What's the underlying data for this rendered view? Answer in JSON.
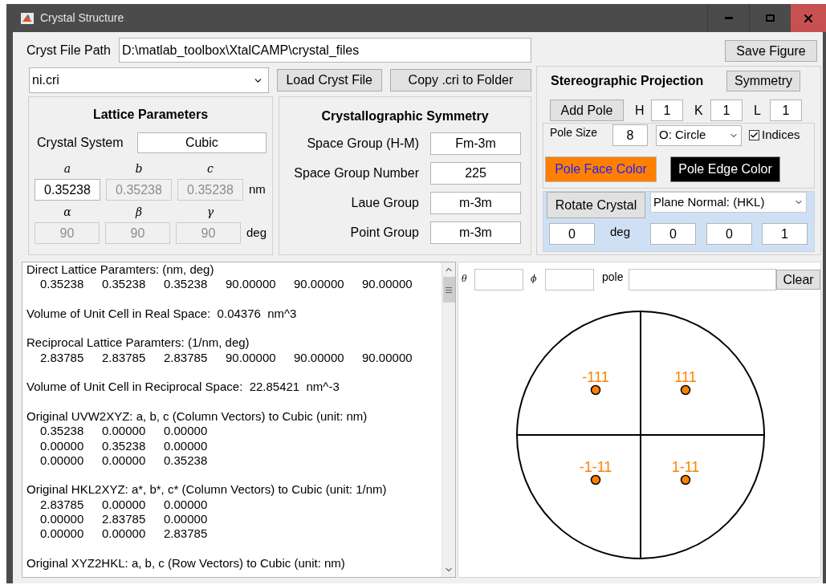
{
  "window": {
    "title": "Crystal Structure"
  },
  "file_path": {
    "label": "Cryst File Path",
    "value": "D:\\matlab_toolbox\\XtalCAMP\\crystal_files"
  },
  "save_button": "Save Figure",
  "file_select": {
    "value": "ni.cri"
  },
  "load_button": "Load Cryst File",
  "copy_button": "Copy .cri to Folder",
  "lattice": {
    "title": "Lattice Parameters",
    "system_label": "Crystal System",
    "system_value": "Cubic",
    "length_unit": "nm",
    "angle_unit": "deg",
    "lengths": [
      {
        "symbol": "a",
        "value": "0.35238",
        "disabled": false
      },
      {
        "symbol": "b",
        "value": "0.35238",
        "disabled": true
      },
      {
        "symbol": "c",
        "value": "0.35238",
        "disabled": true
      }
    ],
    "angles": [
      {
        "symbol": "α",
        "value": "90",
        "disabled": true
      },
      {
        "symbol": "β",
        "value": "90",
        "disabled": true
      },
      {
        "symbol": "γ",
        "value": "90",
        "disabled": true
      }
    ]
  },
  "symmetry": {
    "title": "Crystallographic Symmetry",
    "fields": [
      {
        "label": "Space Group (H-M)",
        "value": "Fm-3m"
      },
      {
        "label": "Space Group Number",
        "value": "225"
      },
      {
        "label": "Laue Group",
        "value": "m-3m"
      },
      {
        "label": "Point Group",
        "value": "m-3m"
      }
    ]
  },
  "stereo": {
    "title": "Stereographic Projection",
    "symmetry_button": "Symmetry",
    "add_pole_button": "Add Pole",
    "indices": [
      {
        "label": "H",
        "value": "1"
      },
      {
        "label": "K",
        "value": "1"
      },
      {
        "label": "L",
        "value": "1"
      }
    ],
    "pole_size_label": "Pole Size",
    "pole_size": "8",
    "marker_select": "O: Circle",
    "show_indices": {
      "label": "Indices",
      "checked": true
    },
    "face_button": {
      "label": "Pole Face Color",
      "color": "#ff8000"
    },
    "edge_button": {
      "label": "Pole Edge Color",
      "color": "#000000"
    },
    "rotate_button": "Rotate Crystal",
    "rotate_mode": "Plane Normal: (HKL)",
    "angle": "0",
    "angle_unit": "deg",
    "axis": [
      "0",
      "0",
      "1"
    ]
  },
  "output": {
    "sections": [
      {
        "title": "Direct Lattice Paramters: (nm, deg)",
        "rows": [
          [
            "0.35238",
            "0.35238",
            "0.35238",
            "90.00000",
            "90.00000",
            "90.00000"
          ]
        ]
      },
      {
        "title": "Volume of Unit Cell in Real Space:  0.04376  nm^3"
      },
      {
        "title": "Reciprocal Lattice Paramters: (1/nm, deg)",
        "rows": [
          [
            "2.83785",
            "2.83785",
            "2.83785",
            "90.00000",
            "90.00000",
            "90.00000"
          ]
        ]
      },
      {
        "title": "Volume of Unit Cell in Reciprocal Space:  22.85421  nm^-3"
      },
      {
        "title": "Original UVW2XYZ: a, b, c (Column Vectors) to Cubic (unit: nm)",
        "rows": [
          [
            "0.35238",
            "0.00000",
            "0.00000"
          ],
          [
            "0.00000",
            "0.35238",
            "0.00000"
          ],
          [
            "0.00000",
            "0.00000",
            "0.35238"
          ]
        ]
      },
      {
        "title": "Original HKL2XYZ: a*, b*, c* (Column Vectors) to Cubic (unit: 1/nm)",
        "rows": [
          [
            "2.83785",
            "0.00000",
            "0.00000"
          ],
          [
            "0.00000",
            "2.83785",
            "0.00000"
          ],
          [
            "0.00000",
            "0.00000",
            "2.83785"
          ]
        ]
      },
      {
        "title": "Original XYZ2HKL: a, b, c (Row Vectors) to Cubic (unit: nm)"
      }
    ]
  },
  "plot": {
    "theta_label": "θ",
    "phi_label": "ϕ",
    "pole_label": "pole",
    "clear_button": "Clear",
    "poles": [
      {
        "label": "-111"
      },
      {
        "label": "111"
      },
      {
        "label": "-1-11"
      },
      {
        "label": "1-11"
      }
    ]
  }
}
